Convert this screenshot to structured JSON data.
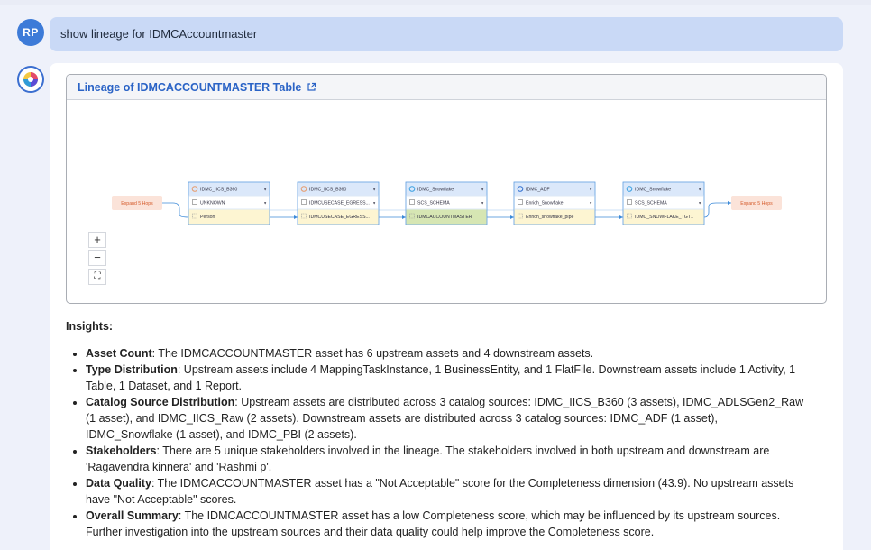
{
  "user": {
    "initials": "RP"
  },
  "query": "show lineage for IDMCAccountmaster",
  "lineage": {
    "title": "Lineage of IDMCACCOUNTMASTER Table",
    "expand_left": "Expand 5 Hops",
    "expand_right": "Expand 5 Hops",
    "nodes": [
      {
        "source": "IDMC_IICS_B360",
        "schema": "UNKNOWN",
        "asset": "Person",
        "source_icon": "b360-icon",
        "highlight": false
      },
      {
        "source": "IDMC_IICS_B360",
        "schema": "IDMCUSECASE_EGRESS...",
        "asset": "IDMCUSECASE_EGRESS...",
        "source_icon": "b360-icon",
        "highlight": false
      },
      {
        "source": "IDMC_Snowflake",
        "schema": "SCS_SCHEMA",
        "asset": "IDMCACCOUNTMASTER",
        "source_icon": "snowflake-icon",
        "highlight": true
      },
      {
        "source": "IDMC_ADF",
        "schema": "Enrich_Snowflake",
        "asset": "Enrich_snowflake_pipe",
        "source_icon": "adf-icon",
        "highlight": false
      },
      {
        "source": "IDMC_Snowflake",
        "schema": "SCS_SCHEMA",
        "asset": "IDMC_SNOWFLAKE_TGT1",
        "source_icon": "snowflake-icon",
        "highlight": false
      }
    ],
    "zoom": {
      "in": "+",
      "out": "−",
      "fit": "⛶"
    }
  },
  "insights": {
    "heading": "Insights:",
    "items": [
      {
        "label": "Asset Count",
        "text": ": The IDMCACCOUNTMASTER asset has 6 upstream assets and 4 downstream assets."
      },
      {
        "label": "Type Distribution",
        "text": ": Upstream assets include 4 MappingTaskInstance, 1 BusinessEntity, and 1 FlatFile. Downstream assets include 1 Activity, 1 Table, 1 Dataset, and 1 Report."
      },
      {
        "label": "Catalog Source Distribution",
        "text": ": Upstream assets are distributed across 3 catalog sources: IDMC_IICS_B360 (3 assets), IDMC_ADLSGen2_Raw (1 asset), and IDMC_IICS_Raw (2 assets). Downstream assets are distributed across 3 catalog sources: IDMC_ADF (1 asset), IDMC_Snowflake (1 asset), and IDMC_PBI (2 assets)."
      },
      {
        "label": "Stakeholders",
        "text": ": There are 5 unique stakeholders involved in the lineage. The stakeholders involved in both upstream and downstream are 'Ragavendra kinnera' and 'Rashmi p'."
      },
      {
        "label": "Data Quality",
        "text": ": The IDMCACCOUNTMASTER asset has a \"Not Acceptable\" score for the Completeness dimension (43.9). No upstream assets have \"Not Acceptable\" scores."
      },
      {
        "label": "Overall Summary",
        "text": ": The IDMCACCOUNTMASTER asset has a low Completeness score, which may be influenced by its upstream sources. Further investigation into the upstream sources and their data quality could help improve the Completeness score."
      }
    ]
  }
}
